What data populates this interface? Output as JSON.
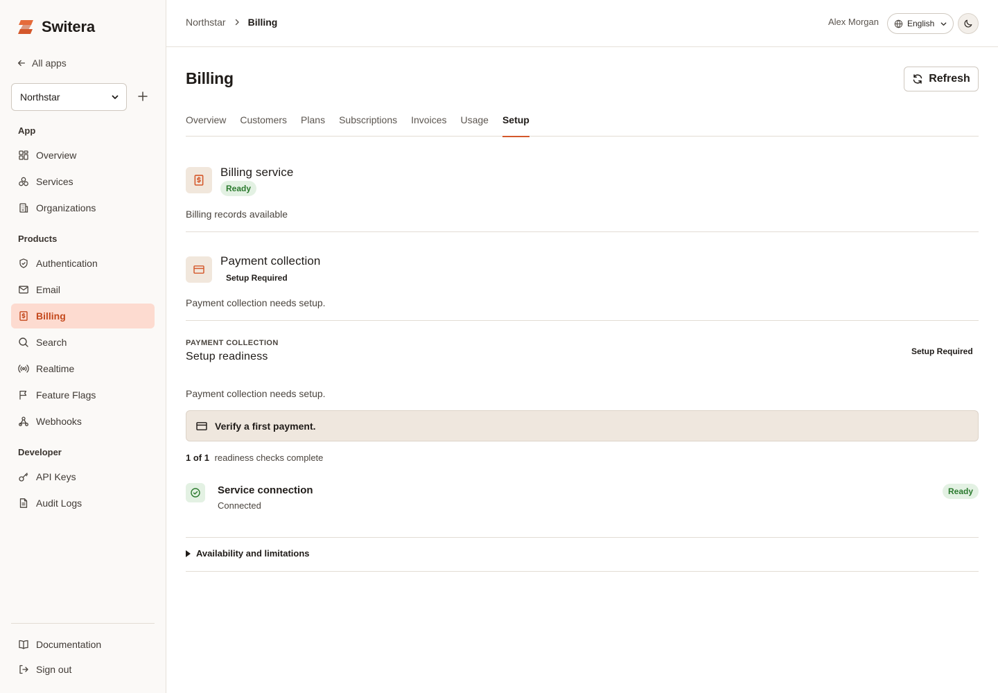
{
  "sidebar": {
    "brand": "Switera",
    "back_label": "All apps",
    "app_select": "Northstar",
    "sections": {
      "app": "App",
      "products": "Products",
      "developer": "Developer"
    },
    "items": {
      "overview": "Overview",
      "services": "Services",
      "organizations": "Organizations",
      "authentication": "Authentication",
      "email": "Email",
      "billing": "Billing",
      "search": "Search",
      "realtime": "Realtime",
      "feature_flags": "Feature Flags",
      "webhooks": "Webhooks",
      "api_keys": "API Keys",
      "audit_logs": "Audit Logs"
    },
    "footer": {
      "documentation": "Documentation",
      "sign_out": "Sign out"
    },
    "active_item": "billing"
  },
  "topbar": {
    "breadcrumb_parent": "Northstar",
    "breadcrumb_current": "Billing",
    "user_name": "Alex Morgan",
    "language": "English"
  },
  "main": {
    "title": "Billing",
    "refresh_label": "Refresh",
    "tabs": [
      "Overview",
      "Customers",
      "Plans",
      "Subscriptions",
      "Invoices",
      "Usage",
      "Setup"
    ],
    "active_tab": "Setup",
    "billing_service": {
      "title": "Billing service",
      "status": "Ready",
      "description": "Billing records available"
    },
    "payment_collection": {
      "title": "Payment collection",
      "status": "Setup Required",
      "description": "Payment collection needs setup."
    },
    "readiness": {
      "eyebrow": "PAYMENT COLLECTION",
      "title": "Setup readiness",
      "status": "Setup Required",
      "description": "Payment collection needs setup.",
      "callout": "Verify a first payment.",
      "checks_count": "1 of 1",
      "checks_text": "readiness checks complete",
      "check": {
        "title": "Service connection",
        "subtitle": "Connected",
        "status": "Ready"
      }
    },
    "details_label": "Availability and limitations"
  },
  "colors": {
    "accent": "#d4582b",
    "active_bg": "#fddbd0",
    "ready_bg": "#e3f1e3",
    "ready_text": "#2b7a2e"
  }
}
